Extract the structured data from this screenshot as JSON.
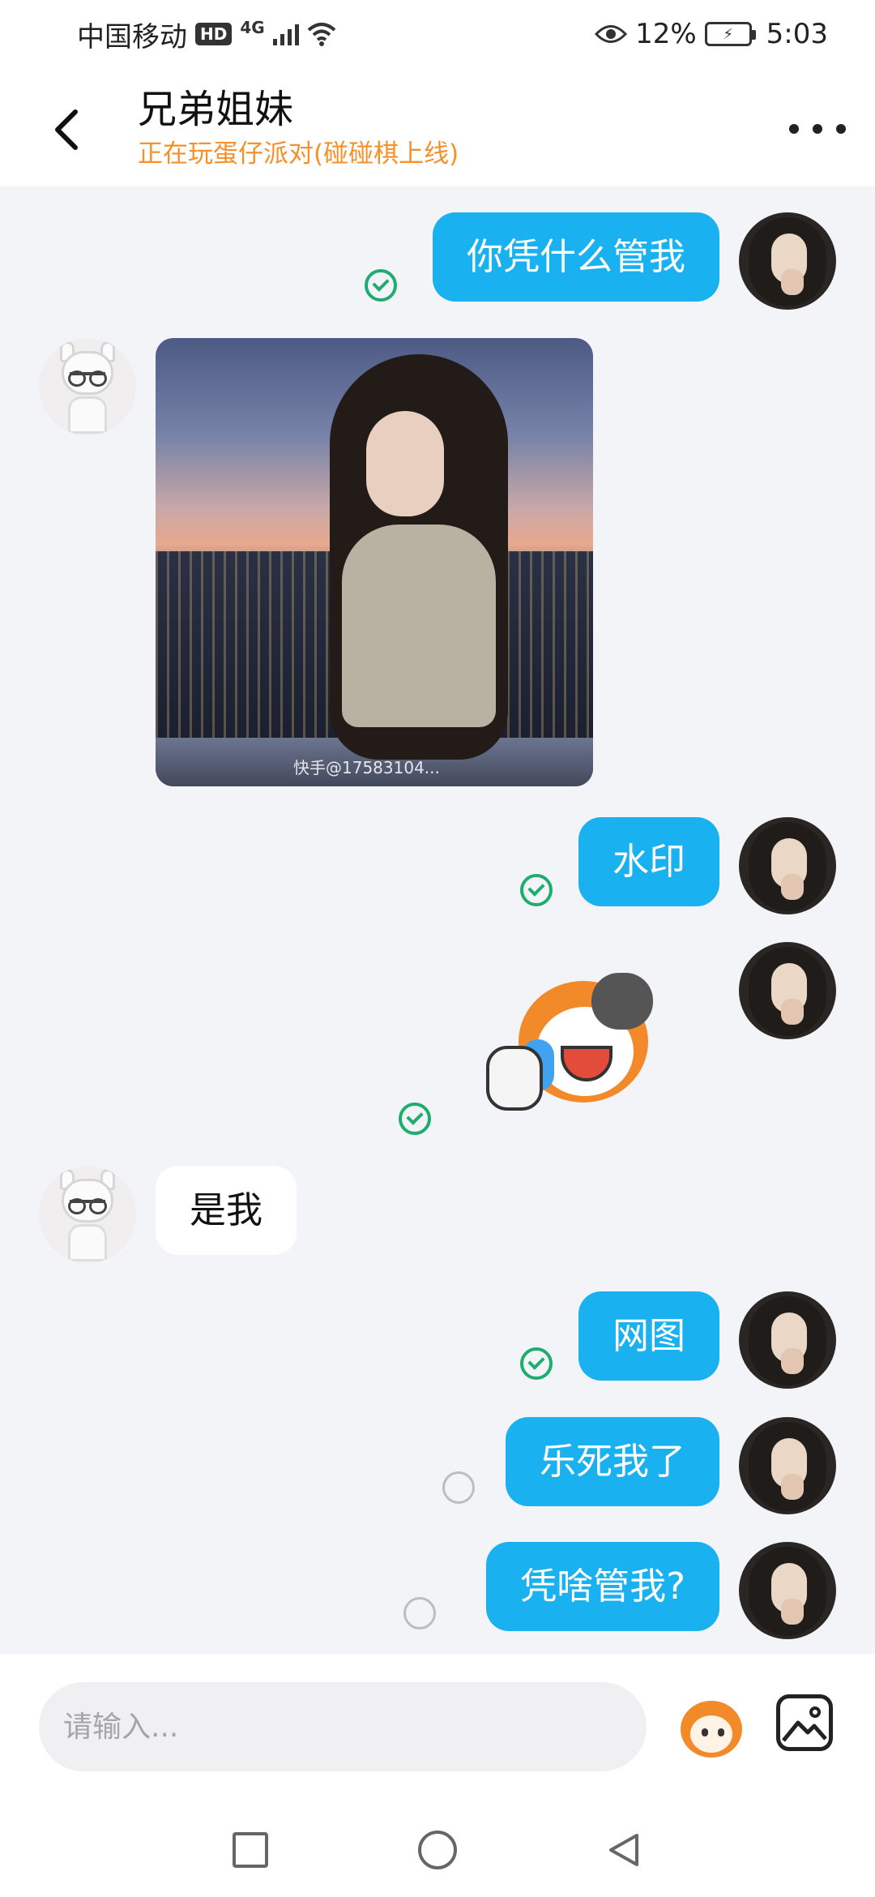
{
  "status_bar": {
    "carrier": "中国移动",
    "hd_badge": "HD",
    "network_type": "4G",
    "battery_percent": "12%",
    "time": "5:03"
  },
  "header": {
    "title": "兄弟姐妹",
    "subtitle": "正在玩蛋仔派对(碰碰棋上线)"
  },
  "messages": [
    {
      "sender": "me",
      "type": "text",
      "text": "你凭什么管我",
      "read": true
    },
    {
      "sender": "other",
      "type": "image",
      "watermark": "快手@17583104..."
    },
    {
      "sender": "me",
      "type": "text",
      "text": "水印",
      "read": true
    },
    {
      "sender": "me",
      "type": "sticker",
      "sticker": "crying-egg-sticker",
      "read": true
    },
    {
      "sender": "other",
      "type": "text",
      "text": "是我"
    },
    {
      "sender": "me",
      "type": "text",
      "text": "网图",
      "read": true
    },
    {
      "sender": "me",
      "type": "text",
      "text": "乐死我了",
      "read": false
    },
    {
      "sender": "me",
      "type": "text",
      "text": "凭啥管我?",
      "read": false
    }
  ],
  "input": {
    "placeholder": "请输入..."
  },
  "icons": {
    "back": "chevron-left-icon",
    "more": "more-dots-icon",
    "emoji": "emoji-icon",
    "image": "image-icon"
  },
  "colors": {
    "outgoing_bubble": "#19b1f0",
    "incoming_bubble": "#ffffff",
    "subtitle": "#f5902a",
    "read_check": "#1fad6f",
    "background": "#f3f4f8"
  }
}
